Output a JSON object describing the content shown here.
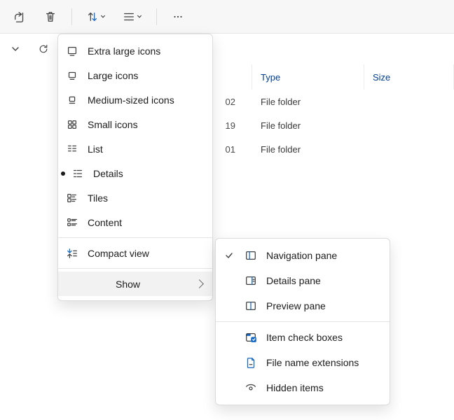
{
  "columns": {
    "type": "Type",
    "size": "Size"
  },
  "rows": [
    {
      "date_tail": "02",
      "type": "File folder"
    },
    {
      "date_tail": "19",
      "type": "File folder"
    },
    {
      "date_tail": "01",
      "type": "File folder"
    }
  ],
  "view_menu": {
    "items": [
      {
        "key": "xl",
        "label": "Extra large icons",
        "icon": "xl-icon"
      },
      {
        "key": "large",
        "label": "Large icons",
        "icon": "large-icon"
      },
      {
        "key": "medium",
        "label": "Medium-sized icons",
        "icon": "medium-icon"
      },
      {
        "key": "small",
        "label": "Small icons",
        "icon": "small-icon"
      },
      {
        "key": "list",
        "label": "List",
        "icon": "list-icon"
      },
      {
        "key": "details",
        "label": "Details",
        "icon": "details-icon",
        "checked": true
      },
      {
        "key": "tiles",
        "label": "Tiles",
        "icon": "tiles-icon"
      },
      {
        "key": "content",
        "label": "Content",
        "icon": "content-icon"
      }
    ],
    "compact_label": "Compact view",
    "show_label": "Show"
  },
  "show_menu": {
    "items": [
      {
        "key": "navpane",
        "label": "Navigation pane",
        "checked": true,
        "icon": "navpane-icon"
      },
      {
        "key": "detpane",
        "label": "Details pane",
        "checked": false,
        "icon": "detpane-icon"
      },
      {
        "key": "prevpane",
        "label": "Preview pane",
        "checked": false,
        "icon": "prevpane-icon"
      },
      {
        "sep": true
      },
      {
        "key": "checkboxes",
        "label": "Item check boxes",
        "icon": "checkboxes-icon"
      },
      {
        "key": "ext",
        "label": "File name extensions",
        "icon": "ext-icon"
      },
      {
        "key": "hidden",
        "label": "Hidden items",
        "icon": "hidden-icon"
      }
    ]
  }
}
